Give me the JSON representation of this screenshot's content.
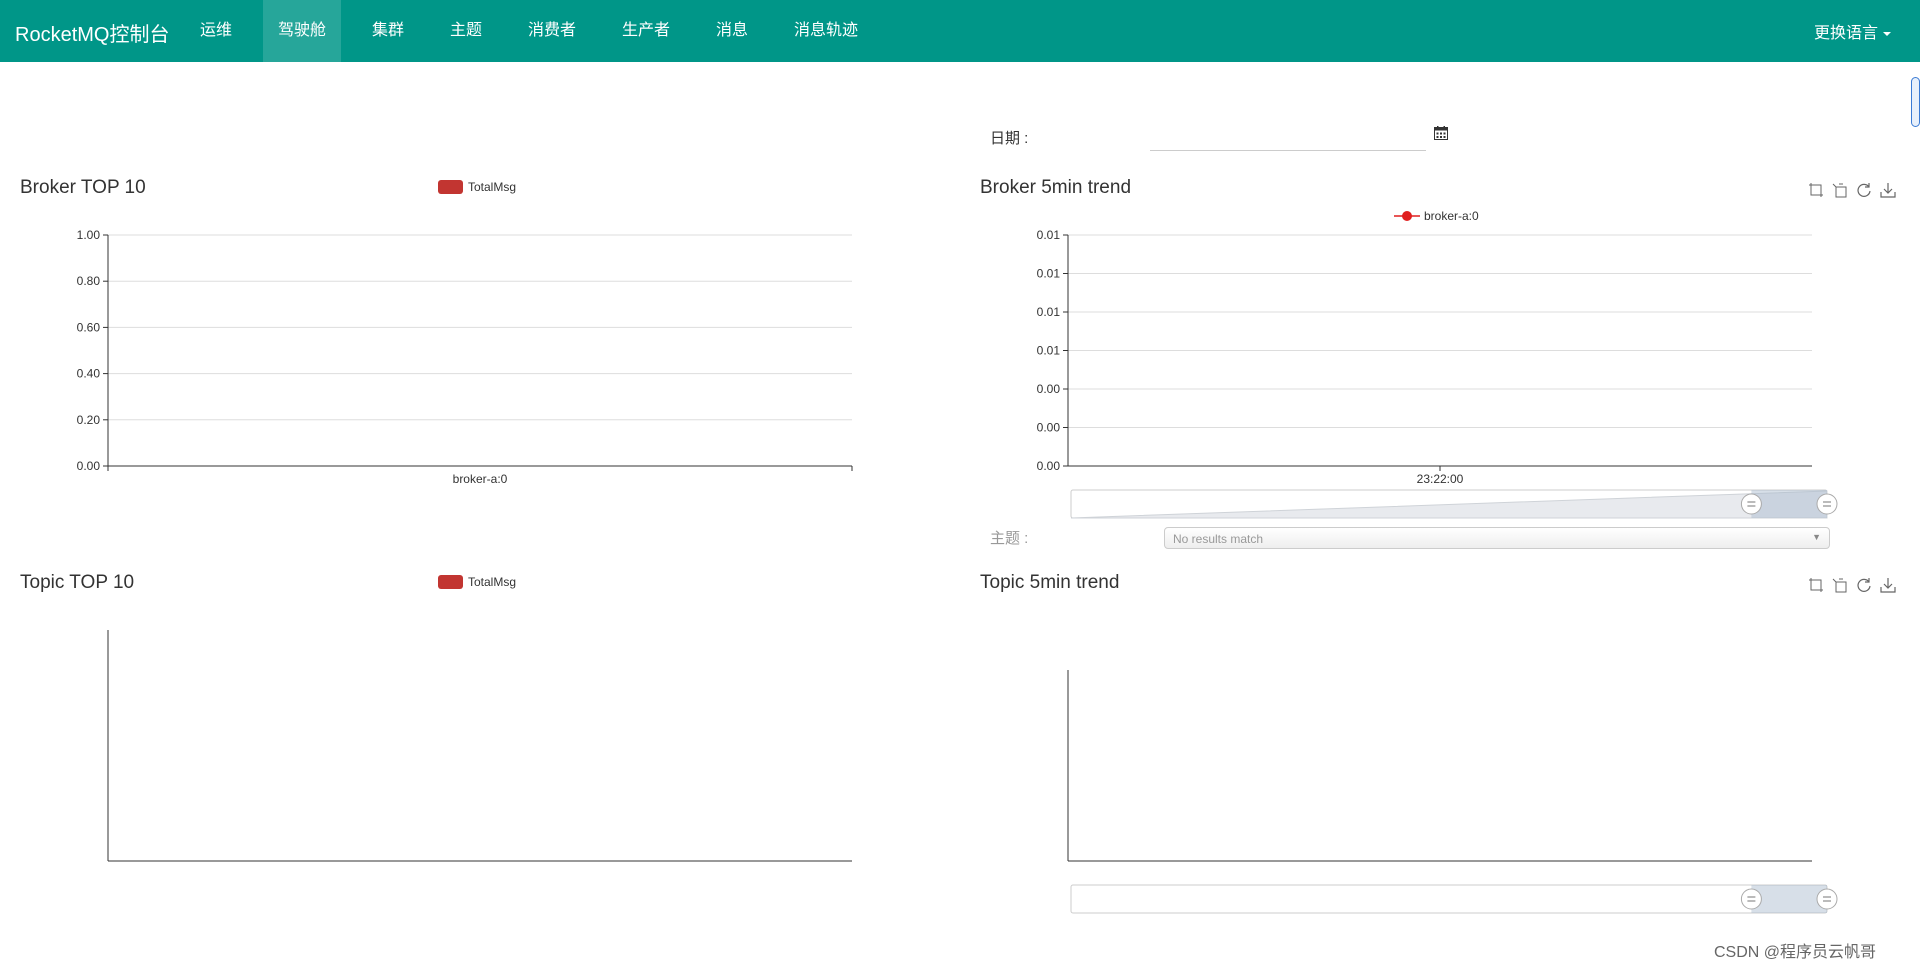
{
  "navbar": {
    "brand": "RocketMQ控制台",
    "items": [
      {
        "label": "运维"
      },
      {
        "label": "驾驶舱",
        "active": true
      },
      {
        "label": "集群"
      },
      {
        "label": "主题"
      },
      {
        "label": "消费者"
      },
      {
        "label": "生产者"
      },
      {
        "label": "消息"
      },
      {
        "label": "消息轨迹"
      }
    ],
    "language": "更换语言",
    "color": "#009688"
  },
  "filters": {
    "date_label": "日期 :",
    "date_value": "",
    "topic_label": "主题 :",
    "topic_placeholder": "No results match"
  },
  "panels": {
    "broker_top": {
      "title": "Broker TOP 10",
      "legend": "TotalMsg"
    },
    "broker_trend": {
      "title": "Broker 5min trend",
      "legend": "broker-a:0"
    },
    "topic_top": {
      "title": "Topic TOP 10",
      "legend": "TotalMsg"
    },
    "topic_trend": {
      "title": "Topic 5min trend"
    }
  },
  "toolbox_icons": [
    "zoom-icon",
    "zoom-reset-icon",
    "restore-icon",
    "save-image-icon"
  ],
  "watermark": "CSDN @程序员云帆哥",
  "chart_data": [
    {
      "type": "bar",
      "title": "Broker TOP 10",
      "categories": [
        "broker-a:0"
      ],
      "series": [
        {
          "name": "TotalMsg",
          "values": [
            0
          ]
        }
      ],
      "ylim": [
        0,
        1
      ],
      "yticks": [
        "0.00",
        "0.20",
        "0.40",
        "0.60",
        "0.80",
        "1.00"
      ],
      "grid": true,
      "legend": "top-center",
      "color": "#c23531"
    },
    {
      "type": "line",
      "title": "Broker 5min trend",
      "x": [
        "23:22:00"
      ],
      "series": [
        {
          "name": "broker-a:0",
          "values": []
        }
      ],
      "yticks": [
        "0.00",
        "0.00",
        "0.00",
        "0.01",
        "0.01",
        "0.01",
        "0.01"
      ],
      "grid": true,
      "legend": "top-center",
      "color": "#e01f1f",
      "datazoom": [
        0.9,
        1.0
      ]
    },
    {
      "type": "bar",
      "title": "Topic TOP 10",
      "categories": [],
      "series": [
        {
          "name": "TotalMsg",
          "values": []
        }
      ],
      "legend": "top-center",
      "color": "#c23531"
    },
    {
      "type": "line",
      "title": "Topic 5min trend",
      "x": [],
      "series": [],
      "datazoom": [
        0.9,
        1.0
      ]
    }
  ]
}
